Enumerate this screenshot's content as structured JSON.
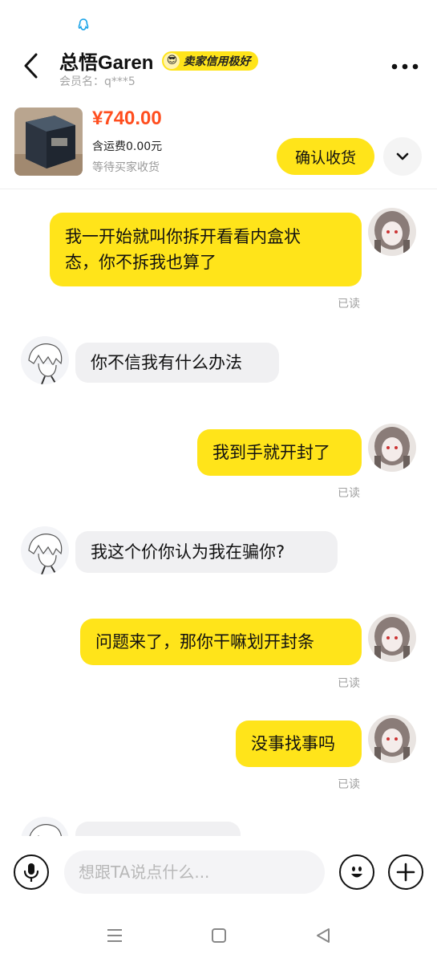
{
  "header": {
    "seller_name": "总悟Garen",
    "credit_badge": "卖家信用极好",
    "member_label": "会员名：",
    "member_id": "q***5"
  },
  "product": {
    "price": "¥740.00",
    "shipping": "含运费0.00元",
    "status": "等待买家收货",
    "confirm_label": "确认收货"
  },
  "messages": [
    {
      "side": "me",
      "lines": [
        "我一开始就叫你拆开看看内盒状",
        "态，你不拆我也算了"
      ],
      "read": "已读"
    },
    {
      "side": "other",
      "lines": [
        "你不信我有什么办法"
      ]
    },
    {
      "side": "me",
      "lines": [
        "我到手就开封了"
      ],
      "read": "已读"
    },
    {
      "side": "other",
      "lines": [
        "我这个价你认为我在骗你?"
      ]
    },
    {
      "side": "me",
      "lines": [
        "问题来了，那你干嘛划开封条"
      ],
      "read": "已读"
    },
    {
      "side": "me",
      "lines": [
        "没事找事吗"
      ],
      "read": "已读"
    }
  ],
  "input": {
    "placeholder": "想跟TA说点什么..."
  },
  "colors": {
    "accent_yellow": "#ffe41a",
    "price_orange": "#ff4e1f",
    "other_bubble": "#f0f0f2"
  },
  "icons": {
    "status": "penguin-icon",
    "back": "chevron-left-icon",
    "more": "more-dots-icon",
    "expand": "chevron-down-icon",
    "voice": "microphone-icon",
    "emoji": "emoji-icon",
    "plus": "plus-icon",
    "nav_menu": "menu-icon",
    "nav_home": "square-icon",
    "nav_back": "triangle-back-icon"
  }
}
